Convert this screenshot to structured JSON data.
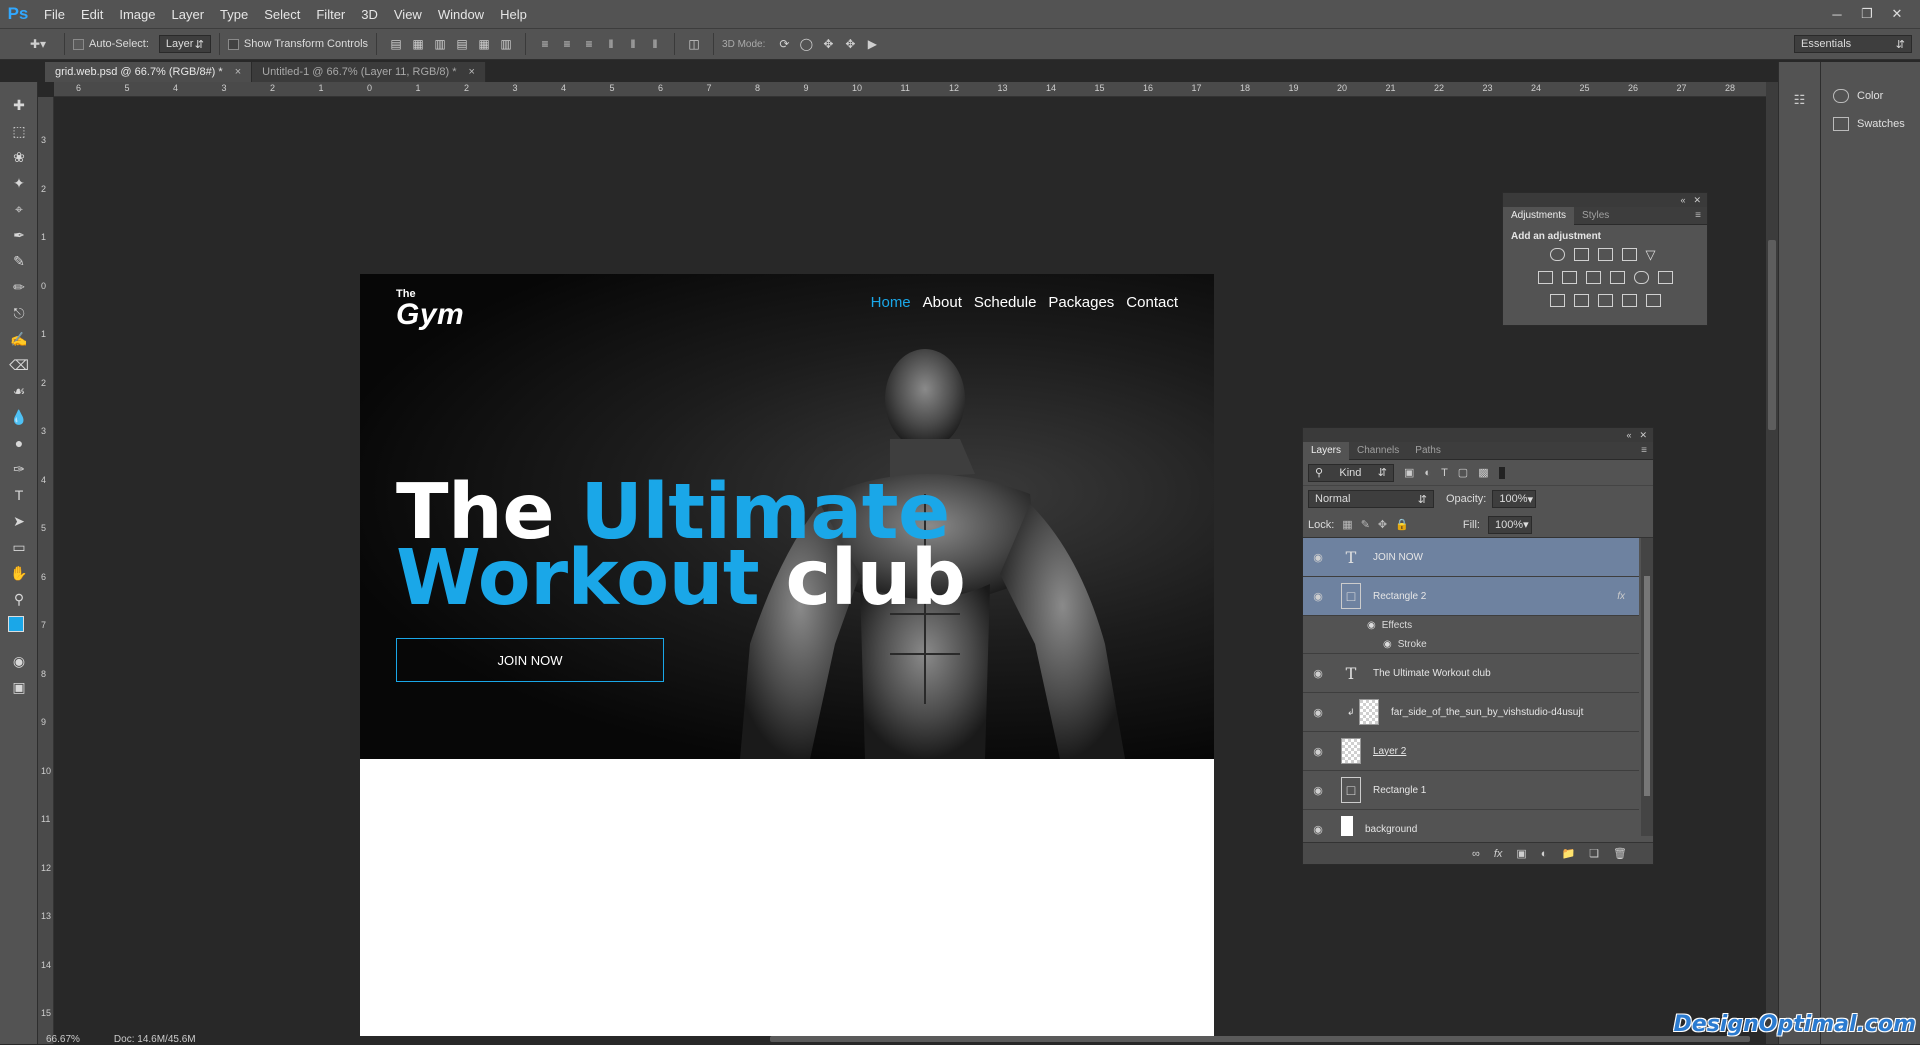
{
  "app": {
    "logo": "Ps"
  },
  "menu": [
    "File",
    "Edit",
    "Image",
    "Layer",
    "Type",
    "Select",
    "Filter",
    "3D",
    "View",
    "Window",
    "Help"
  ],
  "options": {
    "auto_select_label": "Auto-Select:",
    "auto_select_value": "Layer",
    "show_transform_label": "Show Transform Controls",
    "mode_3d_label": "3D Mode:",
    "workspace": "Essentials"
  },
  "tabs": [
    {
      "label": "grid.web.psd @ 66.7% (RGB/8#) *",
      "close": "×"
    },
    {
      "label": "Untitled-1 @ 66.7% (Layer 11, RGB/8) *",
      "close": "×"
    }
  ],
  "ruler_top": [
    "6",
    "5",
    "4",
    "3",
    "2",
    "1",
    "0",
    "1",
    "2",
    "3",
    "4",
    "5",
    "6",
    "7",
    "8",
    "9",
    "10",
    "11",
    "12",
    "13",
    "14",
    "15",
    "16",
    "17",
    "18",
    "19",
    "20",
    "21",
    "22",
    "23",
    "24",
    "25",
    "26",
    "27",
    "28"
  ],
  "ruler_left": [
    "3",
    "2",
    "1",
    "0",
    "1",
    "2",
    "3",
    "4",
    "5",
    "6",
    "7",
    "8",
    "9",
    "10",
    "11",
    "12",
    "13",
    "14",
    "15"
  ],
  "document": {
    "logo_small": "The",
    "logo_big": "Gym",
    "nav": [
      "Home",
      "About",
      "Schedule",
      "Packages",
      "Contact"
    ],
    "headline": {
      "w1": "The",
      "w2": "Ultimate",
      "w3": "Workout",
      "w4": "club"
    },
    "cta": "JOIN NOW",
    "accent_color": "#1aa7e8"
  },
  "dock": {
    "color_label": "Color",
    "swatches_label": "Swatches"
  },
  "adjustments": {
    "tab1": "Adjustments",
    "tab2": "Styles",
    "heading": "Add an adjustment"
  },
  "layers_panel": {
    "tabs": [
      "Layers",
      "Channels",
      "Paths"
    ],
    "kind": "Kind",
    "blend": "Normal",
    "opacity_label": "Opacity:",
    "opacity": "100%",
    "lock_label": "Lock:",
    "fill_label": "Fill:",
    "fill": "100%",
    "layers": [
      {
        "name": "JOIN NOW",
        "type": "text",
        "selected": true
      },
      {
        "name": "Rectangle 2",
        "type": "shape",
        "selected": true,
        "fx": "fx"
      },
      {
        "name": "The Ultimate  Workout club",
        "type": "text"
      },
      {
        "name": "far_side_of_the_sun_by_vishstudio-d4usujt",
        "type": "image"
      },
      {
        "name": "Layer 2",
        "type": "image"
      },
      {
        "name": "Rectangle 1",
        "type": "shape"
      },
      {
        "name": "background",
        "type": "fill"
      }
    ],
    "effects_label": "Effects",
    "stroke_label": "Stroke"
  },
  "status": {
    "zoom": "66.67%",
    "doc": "Doc: 14.6M/45.6M"
  },
  "watermark": "DesignOptimal.com"
}
